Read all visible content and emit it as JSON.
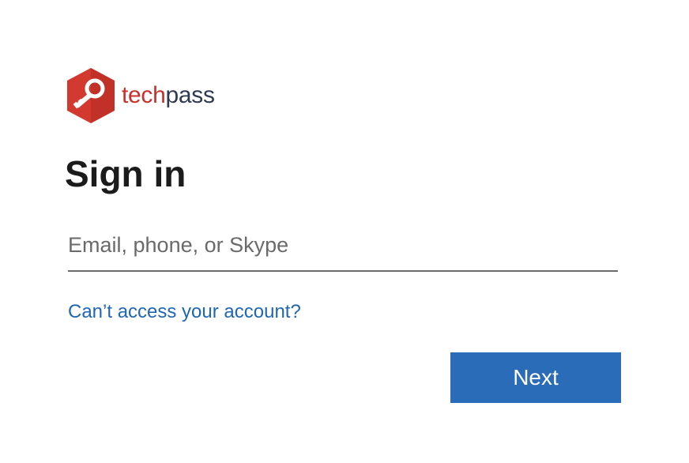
{
  "brand": {
    "name_part1": "tech",
    "name_part2": "pass",
    "logo_icon": "key-hexagon-icon",
    "colors": {
      "logo_red": "#c9302c",
      "logo_dark": "#2e3a4f"
    }
  },
  "page": {
    "title": "Sign in"
  },
  "form": {
    "email_placeholder": "Email, phone, or Skype",
    "email_value": ""
  },
  "links": {
    "cant_access": "Can’t access your account?"
  },
  "actions": {
    "next_label": "Next"
  },
  "colors": {
    "accent": "#2b6cb8",
    "link": "#1f66b4",
    "text": "#1b1b1b",
    "underline": "#6b6b6b"
  }
}
